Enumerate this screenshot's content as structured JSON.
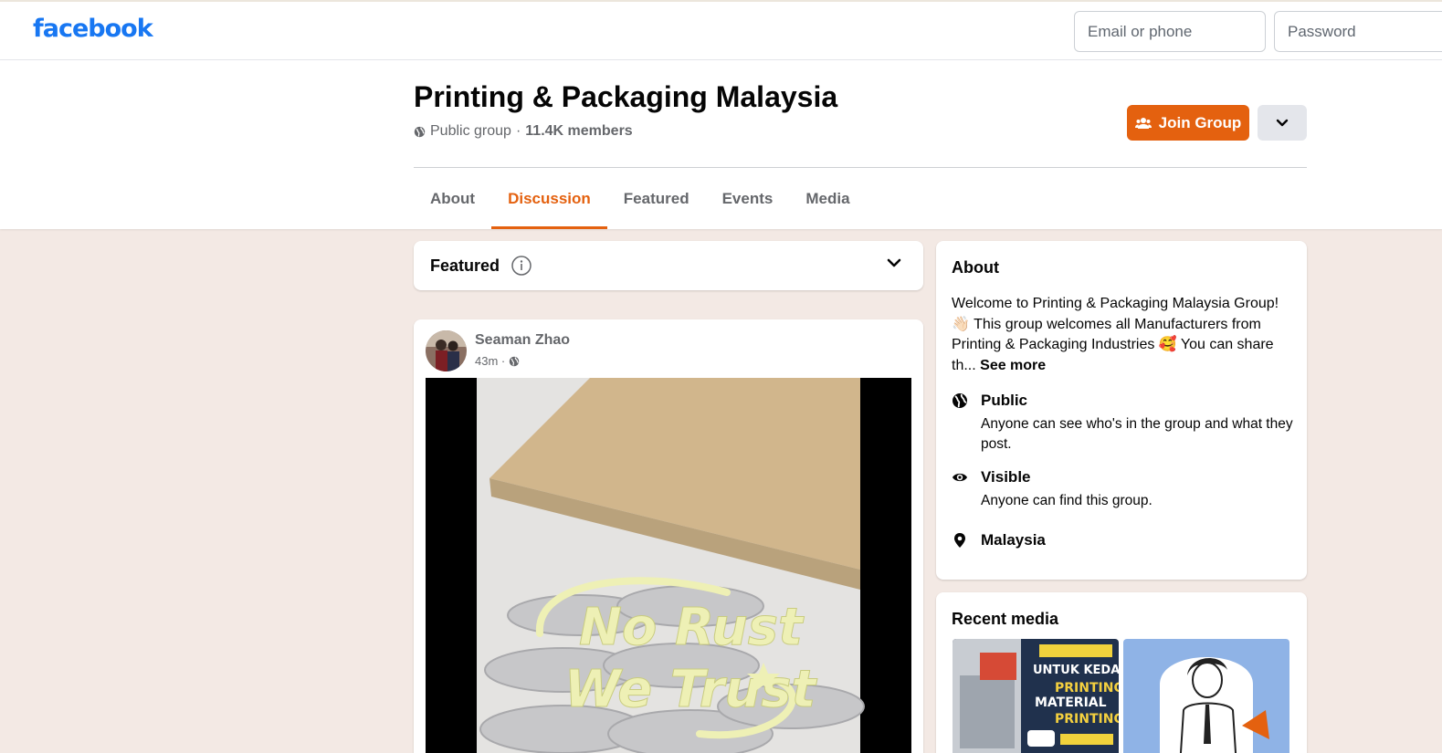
{
  "nav": {
    "logo": "facebook",
    "email_placeholder": "Email or phone",
    "password_placeholder": "Password"
  },
  "group": {
    "name": "Printing & Packaging Malaysia",
    "privacy": "Public group",
    "separator": "·",
    "members": "11.4K members",
    "join_label": "Join Group"
  },
  "tabs": [
    "About",
    "Discussion",
    "Featured",
    "Events",
    "Media"
  ],
  "active_tab": "Discussion",
  "featured": {
    "title": "Featured"
  },
  "post": {
    "author": "Seaman Zhao",
    "time": "43m ·",
    "image_text_line1": "No Rust",
    "image_text_line2": "We Trust"
  },
  "about": {
    "title": "About",
    "description": "Welcome to Printing & Packaging Malaysia Group! 👋🏻 This group welcomes all Manufacturers from Printing & Packaging Industries 🥰 You can share th...",
    "see_more": "See more",
    "public_title": "Public",
    "public_desc": "Anyone can see who's in the group and what they post.",
    "visible_title": "Visible",
    "visible_desc": "Anyone can find this group.",
    "location": "Malaysia"
  },
  "recent_media": {
    "title": "Recent media",
    "thumb1_lines": [
      "UNTUK KEDAI",
      "PRINTING",
      "MATERIAL",
      "PRINTING"
    ]
  },
  "colors": {
    "brand_blue": "#1877f2",
    "accent_orange": "#e4610f",
    "page_bg": "#f3e9e4"
  }
}
